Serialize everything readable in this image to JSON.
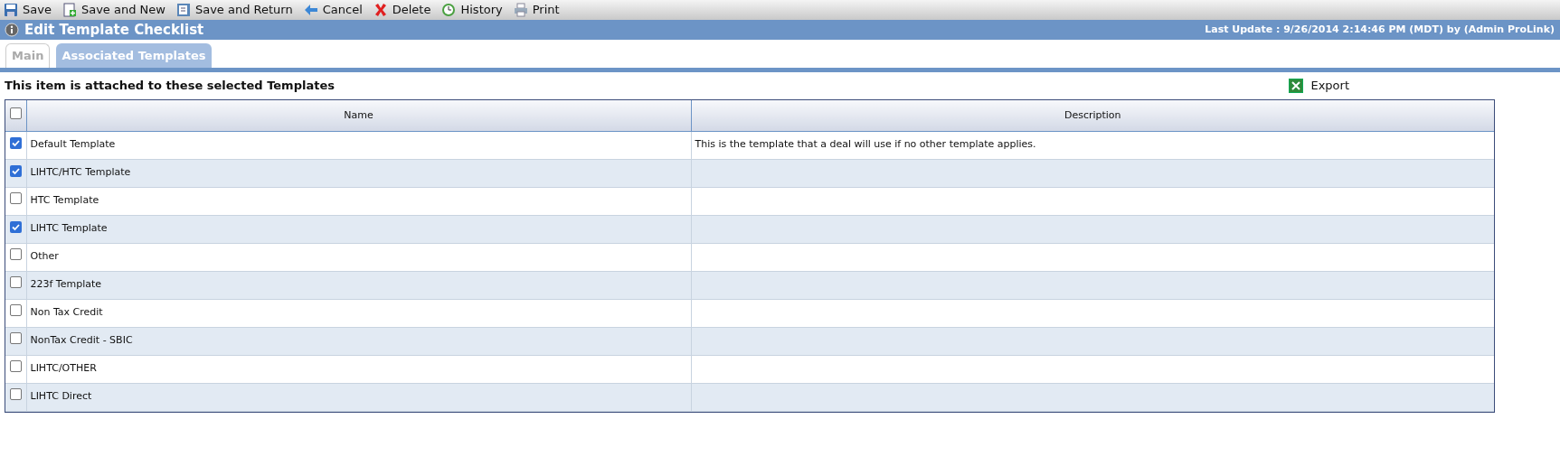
{
  "toolbar": [
    {
      "label": "Save",
      "kind": "save"
    },
    {
      "label": "Save and New",
      "kind": "new"
    },
    {
      "label": "Save and Return",
      "kind": "return"
    },
    {
      "label": "Cancel",
      "kind": "cancel"
    },
    {
      "label": "Delete",
      "kind": "delete"
    },
    {
      "label": "History",
      "kind": "history"
    },
    {
      "label": "Print",
      "kind": "print"
    }
  ],
  "header": {
    "title": "Edit Template Checklist",
    "last_update": "Last Update : 9/26/2014 2:14:46 PM (MDT) by (Admin ProLink)"
  },
  "tabs": [
    {
      "label": "Main",
      "selected": false
    },
    {
      "label": "Associated Templates",
      "selected": true
    }
  ],
  "section_title": "This item is attached to these selected Templates",
  "export": "Export",
  "table": {
    "select_all": {
      "checked": false
    },
    "columns": [
      "Name",
      "Description"
    ],
    "rows": [
      {
        "name": "Default Template",
        "description": "This is the template that a deal will use if no other template applies.",
        "checked": true
      },
      {
        "name": "LIHTC/HTC Template",
        "checked": true
      },
      {
        "name": "HTC Template",
        "checked": false
      },
      {
        "name": "LIHTC Template",
        "checked": true
      },
      {
        "name": "Other",
        "checked": false
      },
      {
        "name": "223f Template",
        "checked": false
      },
      {
        "name": "Non Tax Credit",
        "checked": false
      },
      {
        "name": "NonTax Credit - SBIC",
        "checked": false
      },
      {
        "name": "LIHTC/OTHER",
        "checked": false
      },
      {
        "name": "LIHTC Direct",
        "checked": false
      }
    ]
  }
}
